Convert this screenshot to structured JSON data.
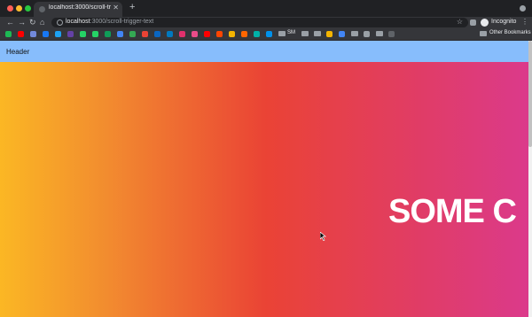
{
  "browser": {
    "tab_title": "localhost:3000/scroll-trigger-te",
    "url_host": "localhost",
    "url_path": ":3000/scroll-trigger-text",
    "profile_label": "Incognito",
    "bookmarks": {
      "sm": "SM",
      "other": "Other Bookmarks"
    },
    "colors": {
      "close": "#ff5f57",
      "minimize": "#febc2e",
      "maximize": "#28c840"
    }
  },
  "page": {
    "header_text": "Header",
    "hero_text": "SOME C",
    "gradient": [
      "#fbb724",
      "#f28c2f",
      "#ea4335",
      "#e03c68",
      "#db3a8c"
    ],
    "header_bg": "#87bdfc"
  }
}
